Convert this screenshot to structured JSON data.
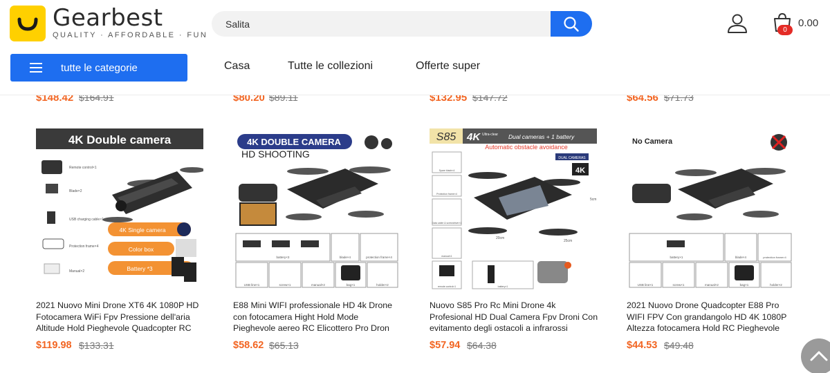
{
  "header": {
    "logo_name": "Gearbest",
    "logo_tagline": "QUALITY · AFFORDABLE · FUN",
    "search_value": "Salita",
    "cart_count": "0",
    "cart_total": "0.00",
    "categories_label": "tutte le categorie",
    "nav": [
      "Casa",
      "Tutte le collezioni",
      "Offerte super"
    ]
  },
  "previous_row": [
    {
      "price": "$148.42",
      "old_price": "$164.91"
    },
    {
      "price": "$80.20",
      "old_price": "$89.11"
    },
    {
      "price": "$132.95",
      "old_price": "$147.72"
    },
    {
      "price": "$64.56",
      "old_price": "$71.73"
    }
  ],
  "products": [
    {
      "title": "2021 Nuovo Mini Drone XT6 4K 1080P HD Fotocamera WiFi Fpv Pressione dell'aria Altitude Hold Pieghevole Quadcopter RC",
      "price": "$119.98",
      "old_price": "$133.31",
      "image": {
        "banner": "4K Double camera",
        "tag1": "4K Single camera",
        "tag2": "Color box",
        "tag3": "Battery *3",
        "labels": [
          "Remote control×1",
          "Blade×2",
          "USB charging cable×1",
          "Protection frame×4",
          "Manual×2"
        ]
      }
    },
    {
      "title": "E88 Mini WIFI professionale HD 4k Drone con fotocamera Hight Hold Mode Pieghevole aereo RC Elicottero Pro Dron",
      "price": "$58.62",
      "old_price": "$65.13",
      "image": {
        "banner": "4K DOUBLE CAMERA",
        "sub": "HD SHOOTING",
        "labels": [
          "battery×3",
          "blade×4",
          "protection frame×4",
          "USB line×1",
          "screw×1",
          "manual×2",
          "bag×1",
          "holder×2"
        ]
      }
    },
    {
      "title": "Nuovo S85 Pro Rc Mini Drone 4k Profesional HD Dual Camera Fpv Droni Con evitamento degli ostacoli a infrarossi",
      "price": "$57.94",
      "old_price": "$64.38",
      "image": {
        "model": "S85",
        "banner": "4K",
        "banner_small": "Ultra-clear",
        "banner_rest": "Dual cameras + 1 battery",
        "sub": "Automatic obstacle avoidance",
        "badge_top": "DUAL CAMERAS",
        "badge_4k": "4K",
        "dims": [
          "20cm",
          "25cm",
          "5cm"
        ],
        "labels": [
          "Spare blade×4",
          "Protection frame×4",
          "Data cable & screwdriver×1",
          "manual×1",
          "remote control×1",
          "battery×1"
        ]
      }
    },
    {
      "title": "2021 Nuovo Drone Quadcopter E88 Pro WIFI FPV Con grandangolo HD 4K 1080P Altezza fotocamera Hold RC Pieghevole",
      "price": "$44.53",
      "old_price": "$49.48",
      "image": {
        "banner": "No Camera",
        "labels": [
          "battery×1",
          "blade×4",
          "protection frame×4",
          "USB line×1",
          "screw×1",
          "manual×2",
          "bag×1",
          "holder×2"
        ]
      }
    }
  ],
  "icons": {
    "search": "search-icon",
    "user": "user-icon",
    "cart": "cart-icon",
    "menu": "menu-icon",
    "scroll_top": "chevron-up-icon"
  },
  "colors": {
    "accent_blue": "#1e6ef0",
    "price_orange": "#f26522",
    "logo_yellow": "#ffd000",
    "badge_red": "#e42b26"
  }
}
